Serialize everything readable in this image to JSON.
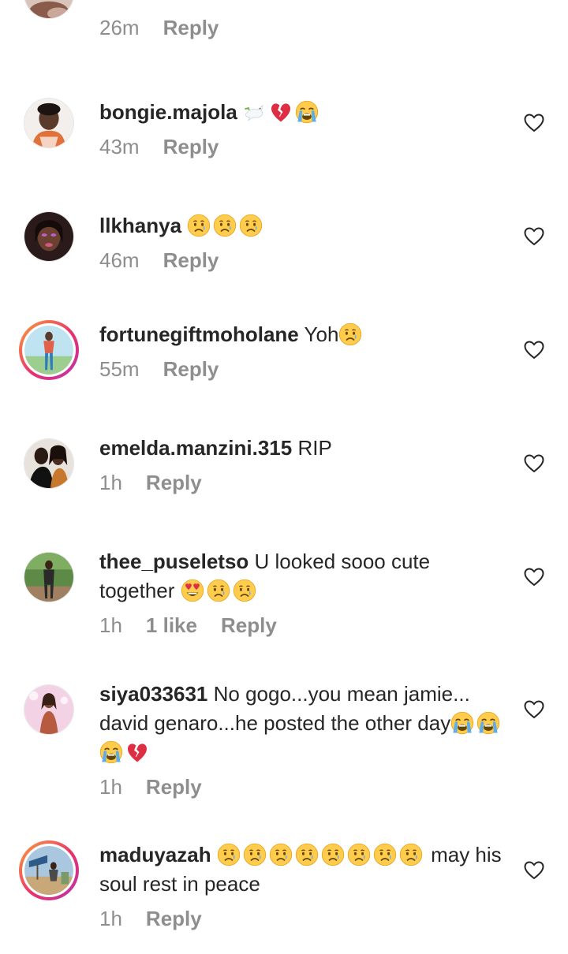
{
  "top_comment": {
    "time": "26m",
    "reply_label": "Reply"
  },
  "comments": [
    {
      "username": "bongie.majola",
      "text": "",
      "emojis": [
        "dove-emoji",
        "broken-heart-emoji",
        "loudly-crying-face-emoji"
      ],
      "time": "43m",
      "likes": "",
      "reply_label": "Reply",
      "story_ring": false
    },
    {
      "username": "llkhanya",
      "text": "",
      "emojis": [
        "sad-tear-face-emoji",
        "sad-tear-face-emoji",
        "sad-tear-face-emoji"
      ],
      "time": "46m",
      "likes": "",
      "reply_label": "Reply",
      "story_ring": false
    },
    {
      "username": "fortunegiftmoholane",
      "text": "Yoh",
      "emojis": [
        "sad-tear-face-emoji"
      ],
      "time": "55m",
      "likes": "",
      "reply_label": "Reply",
      "story_ring": true
    },
    {
      "username": "emelda.manzini.315",
      "text": "RIP",
      "emojis": [],
      "time": "1h",
      "likes": "",
      "reply_label": "Reply",
      "story_ring": false
    },
    {
      "username": "thee_puseletso",
      "text": "U looked sooo cute together",
      "emojis": [
        "heart-eyes-face-emoji",
        "sad-tear-face-emoji",
        "sad-tear-face-emoji"
      ],
      "time": "1h",
      "likes": "1 like",
      "reply_label": "Reply",
      "story_ring": false
    },
    {
      "username": "siya033631",
      "text": "No gogo...you mean jamie... david genaro...he posted the other day",
      "emojis": [
        "loudly-crying-face-emoji",
        "loudly-crying-face-emoji",
        "loudly-crying-face-emoji",
        "broken-heart-emoji"
      ],
      "time": "1h",
      "likes": "",
      "reply_label": "Reply",
      "story_ring": false
    },
    {
      "username": "maduyazah",
      "text_after": "may his soul rest in peace",
      "emojis": [
        "sad-tear-face-emoji",
        "sad-tear-face-emoji",
        "sad-tear-face-emoji",
        "sad-tear-face-emoji",
        "sad-tear-face-emoji",
        "sad-tear-face-emoji",
        "sad-tear-face-emoji",
        "sad-tear-face-emoji"
      ],
      "time": "1h",
      "likes": "",
      "reply_label": "Reply",
      "story_ring": true
    }
  ],
  "icons": {
    "like": "heart-outline-icon"
  },
  "colors": {
    "text": "#262626",
    "meta": "#8e8e8e",
    "story_ring_start": "#f9a13a",
    "story_ring_end": "#b933ad"
  }
}
